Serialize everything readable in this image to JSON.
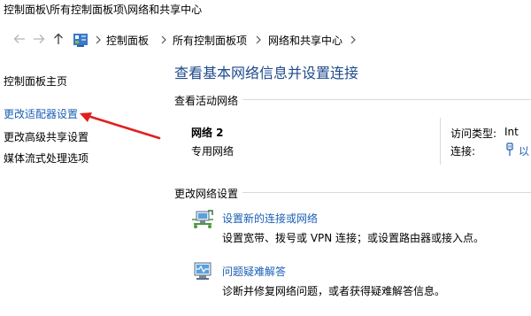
{
  "window": {
    "title": "控制面板\\所有控制面板项\\网络和共享中心"
  },
  "nav": {
    "breadcrumbs": [
      "控制面板",
      "所有控制面板项",
      "网络和共享中心"
    ],
    "separator": "›"
  },
  "sidebar": {
    "items": [
      {
        "label": "控制面板主页"
      },
      {
        "label": "更改适配器设置"
      },
      {
        "label": "更改高级共享设置"
      },
      {
        "label": "媒体流式处理选项"
      }
    ]
  },
  "main": {
    "heading": "查看基本网络信息并设置连接",
    "active_networks_label": "查看活动网络",
    "network": {
      "name": "网络 2",
      "type": "专用网络",
      "access_type_label": "访问类型:",
      "access_type_value": "Int",
      "connections_label": "连接:",
      "connections_value": "以"
    },
    "change_settings_label": "更改网络设置",
    "tasks": [
      {
        "link": "设置新的连接或网络",
        "description": "设置宽带、拨号或 VPN 连接；或设置路由器或接入点。",
        "icon": "new-connection-icon"
      },
      {
        "link": "问题疑难解答",
        "description": "诊断并修复网络问题，或者获得疑难解答信息。",
        "icon": "troubleshoot-icon"
      }
    ]
  },
  "annotation": {
    "color": "#e02020",
    "icon": "red-arrow-icon"
  },
  "colors": {
    "link": "#1a5fb4",
    "heading": "#1e4a8c",
    "divider": "#d9d9d9"
  }
}
